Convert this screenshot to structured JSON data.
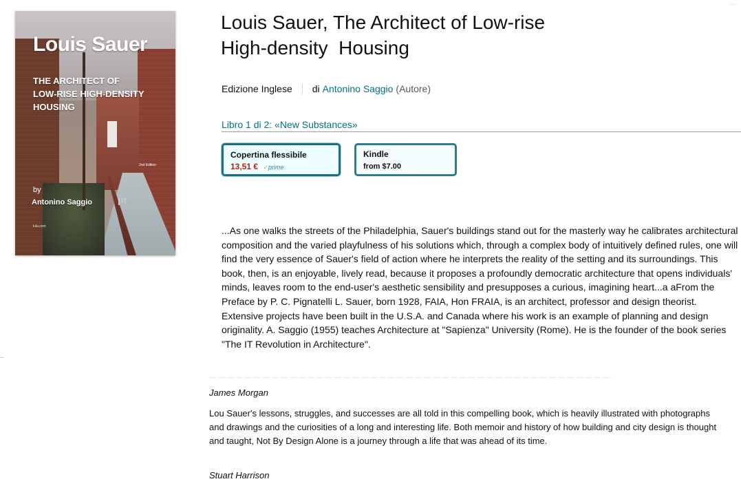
{
  "cover": {
    "title": "Louis Sauer",
    "subtitle_lines": [
      "THE ARCHITECT OF",
      "LOW-RISE HIGH-DENSITY",
      "HOUSING"
    ],
    "edition": "2nd Edition",
    "by": "by",
    "author": "Antonino Saggio",
    "logo": "IT",
    "footer": "lulu.com"
  },
  "product": {
    "title_line1": "Louis Sauer, The Architect of Low-rise",
    "title_line2": "High-density  Housing",
    "format": "Edizione Inglese",
    "by_prefix": "di",
    "author": "Antonino Saggio",
    "author_role": "(Autore)",
    "series": "Libro 1 di 2: «New Substances»"
  },
  "formats": [
    {
      "label": "Copertina flessibile",
      "price": "13,51 €",
      "prime": "prime",
      "selected": true
    },
    {
      "label": "Kindle",
      "price": "from $7.00",
      "selected": false
    }
  ],
  "description": "...As one walks the streets of the Philadelphia, Sauer's buildings stand out for the masterly way he calibrates architectural composition and the varied playfulness of his solutions which, through a complex body of intuitively defined rules, one will find the very essence of Sauer's field of action where he interprets the reality of the setting and its surroundings. This book, then, is an enjoyable, lively read, because it proposes a profoundly democratic architecture that opens individuals' minds, leaves room to the end-user's aesthetic sensibility and presupposes a curious, imagining heart...a aFrom the Preface by P. C. Pignatelli L. Sauer, born 1928, FAIA, Hon FRAIA, is an architect, professor and design theorist. Extensive projects have been built in the U.S.A. and Canada where his work is an example of planning and design originality. A. Saggio (1955) teaches Architecture at \"Sapienza\" University (Rome). He is the founder of the book series \"The IT Revolution in Architecture\".",
  "reviews": [
    {
      "reviewer": "James Morgan",
      "text": "Lou Sauer's lessons, struggles, and successes are all told in this compelling book, which is heavily illustrated with photographs and drawings and the curiosities of a long and interesting life. Both memoir and history of how building and city design is thought and taught, Not By Design Alone is a journey through a life that was ahead of its time."
    },
    {
      "reviewer": "Stuart Harrison"
    }
  ]
}
